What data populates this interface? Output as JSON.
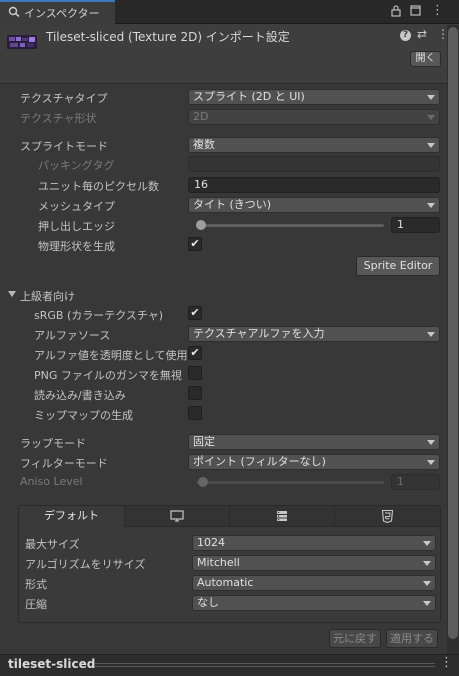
{
  "window": {
    "tab_title": "インスペクター",
    "lock_icon": "lock-icon",
    "maximize_icon": "maximize-icon",
    "menu_icon": "kebab-menu-icon"
  },
  "header": {
    "asset_title": "Tileset-sliced (Texture 2D) インポート設定",
    "open_button": "開く"
  },
  "texture": {
    "type_label": "テクスチャタイプ",
    "type_value": "スプライト (2D と UI)",
    "shape_label": "テクスチャ形状",
    "shape_value": "2D"
  },
  "sprite": {
    "mode_label": "スプライトモード",
    "mode_value": "複数",
    "packing_tag_label": "パッキングタグ",
    "packing_tag_value": "",
    "ppu_label": "ユニット毎のピクセル数",
    "ppu_value": "16",
    "mesh_type_label": "メッシュタイプ",
    "mesh_type_value": "タイト (きつい)",
    "extrude_label": "押し出しエッジ",
    "extrude_value": "1",
    "physics_shape_label": "物理形状を生成",
    "physics_shape_checked": true,
    "editor_button": "Sprite Editor"
  },
  "advanced": {
    "section_label": "上級者向け",
    "srgb_label": "sRGB (カラーテクスチャ)",
    "srgb_checked": true,
    "alpha_source_label": "アルファソース",
    "alpha_source_value": "テクスチャアルファを入力",
    "alpha_transparency_label": "アルファ値を透明度として使用",
    "alpha_transparency_checked": true,
    "ignore_png_gamma_label": "PNG ファイルのガンマを無視",
    "ignore_png_gamma_checked": false,
    "read_write_label": "読み込み/書き込み",
    "read_write_checked": false,
    "mipmap_label": "ミップマップの生成",
    "mipmap_checked": false
  },
  "wrap": {
    "wrap_label": "ラップモード",
    "wrap_value": "固定",
    "filter_label": "フィルターモード",
    "filter_value": "ポイント (フィルターなし)",
    "aniso_label": "Aniso Level",
    "aniso_value": "1"
  },
  "platform": {
    "tabs": [
      {
        "label": "デフォルト",
        "icon": ""
      },
      {
        "label": "",
        "icon": "monitor-icon"
      },
      {
        "label": "",
        "icon": "server-icon"
      },
      {
        "label": "",
        "icon": "html5-icon"
      }
    ],
    "max_size_label": "最大サイズ",
    "max_size_value": "1024",
    "resize_label": "アルゴリズムをリサイズ",
    "resize_value": "Mitchell",
    "format_label": "形式",
    "format_value": "Automatic",
    "compression_label": "圧縮",
    "compression_value": "なし"
  },
  "actions": {
    "revert_button": "元に戻す",
    "apply_button": "適用する"
  },
  "footer": {
    "asset_name": "tileset-sliced"
  }
}
